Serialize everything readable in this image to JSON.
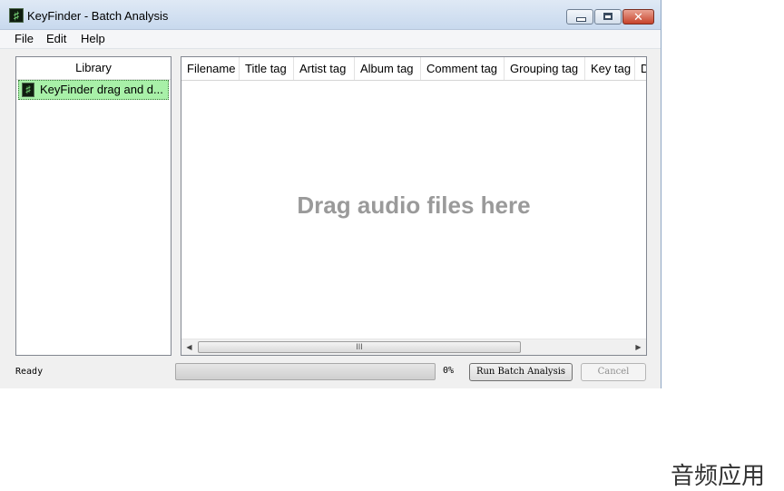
{
  "window": {
    "title": "KeyFinder - Batch Analysis",
    "controls": {
      "minimize": "minimize-icon",
      "maximize": "maximize-icon",
      "close": "✕"
    }
  },
  "menu": [
    "File",
    "Edit",
    "Help"
  ],
  "library": {
    "header": "Library",
    "items": [
      {
        "label": "KeyFinder drag and d...",
        "icon": "keyfinder-app-icon"
      }
    ]
  },
  "table": {
    "columns": [
      "Filename",
      "Title tag",
      "Artist tag",
      "Album tag",
      "Comment tag",
      "Grouping tag",
      "Key tag",
      "D"
    ],
    "drop_hint": "Drag audio files here",
    "scroll_grip": "III"
  },
  "status": {
    "text": "Ready",
    "progress": 0,
    "progress_label": "0%"
  },
  "buttons": {
    "run": "Run Batch Analysis",
    "cancel": "Cancel"
  },
  "watermark": "音频应用"
}
